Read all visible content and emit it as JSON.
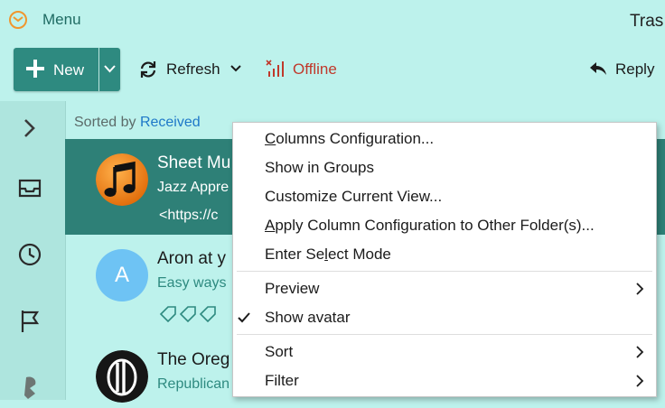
{
  "topbar": {
    "menu_label": "Menu",
    "folder_title_fragment": "Tras"
  },
  "toolbar": {
    "new_label": "New",
    "refresh_label": "Refresh",
    "offline_label": "Offline",
    "reply_label": "Reply"
  },
  "list": {
    "sorted_prefix": "Sorted by",
    "sorted_key": "Received",
    "rows": [
      {
        "subject": "Sheet Mu",
        "line2": "Jazz Appre",
        "line3": "<https://c",
        "avatar": "music-note-icon"
      },
      {
        "subject": "Aron at y",
        "line2": "Easy ways",
        "avatar_letter": "A"
      },
      {
        "subject": "The Oreg",
        "line2": "Republican",
        "avatar": "oregonian-logo"
      }
    ]
  },
  "context_menu": {
    "columns_configuration": {
      "pre": "",
      "u": "C",
      "post": "olumns Configuration..."
    },
    "show_in_groups": {
      "pre": "Show in Groups",
      "u": "",
      "post": ""
    },
    "customize_current_view": {
      "pre": "Customize Current View...",
      "u": "",
      "post": ""
    },
    "apply_column_configuration": {
      "pre": "",
      "u": "A",
      "post": "pply Column Configuration to Other Folder(s)..."
    },
    "enter_select_mode": {
      "pre": "Enter Se",
      "u": "l",
      "post": "ect Mode"
    },
    "preview": {
      "pre": "Preview",
      "u": "",
      "post": ""
    },
    "show_avatar": {
      "pre": "Show avatar",
      "u": "",
      "post": ""
    },
    "sort": {
      "pre": "Sort",
      "u": "",
      "post": ""
    },
    "filter": {
      "pre": "Filter",
      "u": "",
      "post": ""
    }
  },
  "colors": {
    "background": "#bdf2ec",
    "accent": "#2e8a80",
    "selected_row": "#2e8077",
    "offline_red": "#c0392b",
    "link_blue": "#1e78c8"
  }
}
